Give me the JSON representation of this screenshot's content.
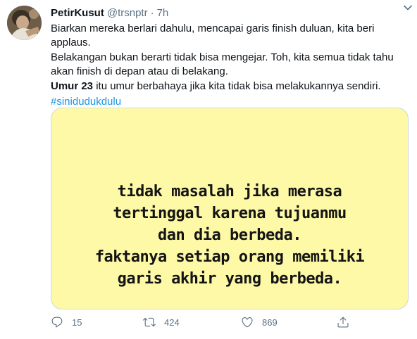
{
  "tweet": {
    "display_name": "PetirKusut",
    "handle": "@trsnptr",
    "separator": "·",
    "time": "7h",
    "line1": "Biarkan mereka berlari dahulu, mencapai garis finish duluan, kita beri applaus.",
    "line2": "Belakangan bukan berarti tidak bisa mengejar. Toh, kita semua tidak tahu akan finish di depan atau di belakang.",
    "line3_bold": "Umur 23",
    "line3_rest": " itu umur berbahaya jika kita tidak bisa melakukannya sendiri.",
    "hashtag": "#sinidudukdulu"
  },
  "media": {
    "background": "#fdf9a6",
    "quote_lines": [
      "tidak masalah jika merasa",
      "tertinggal karena tujuanmu",
      "dan dia berbeda.",
      "faktanya setiap orang memiliki",
      "garis akhir yang berbeda."
    ]
  },
  "actions": {
    "reply_count": "15",
    "retweet_count": "424",
    "like_count": "869"
  },
  "icons": {
    "caret": "chevron-down-icon",
    "reply": "reply-icon",
    "retweet": "retweet-icon",
    "like": "heart-icon",
    "share": "share-icon"
  },
  "colors": {
    "text": "#0f1419",
    "secondary": "#5b7083",
    "link": "#1b95e0"
  }
}
